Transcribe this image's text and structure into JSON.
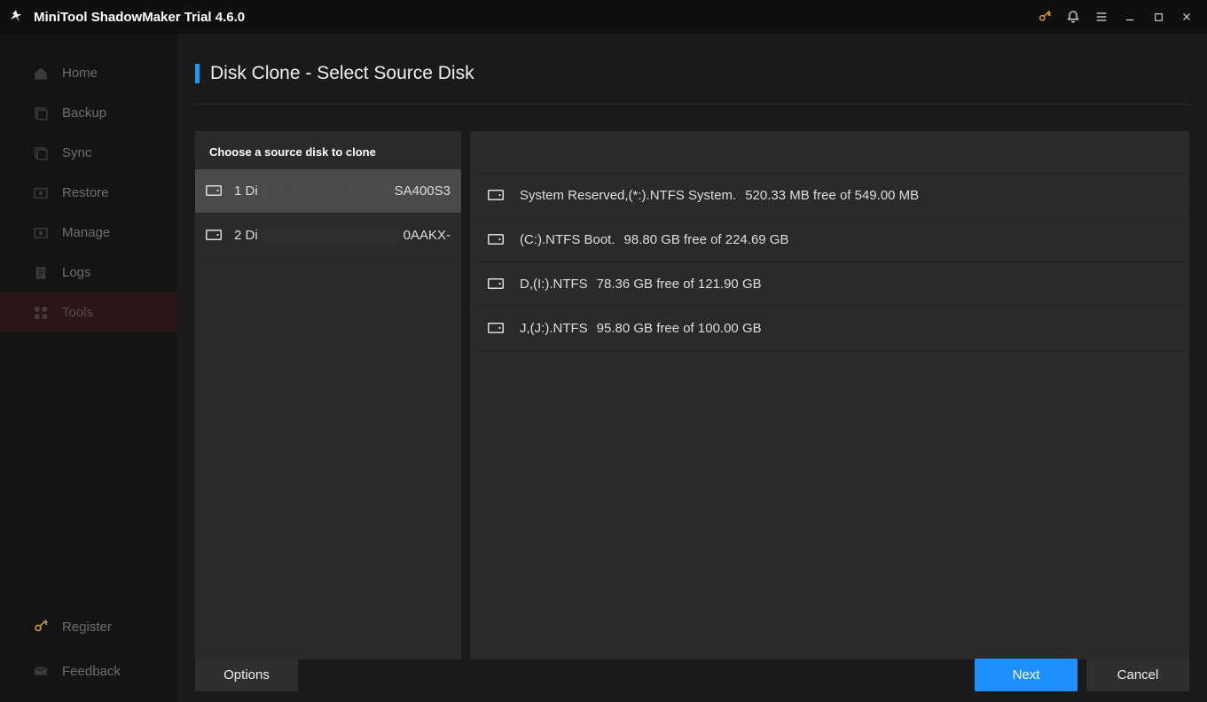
{
  "app": {
    "title": "MiniTool ShadowMaker Trial 4.6.0"
  },
  "sidebar": {
    "items": [
      {
        "label": "Home"
      },
      {
        "label": "Backup"
      },
      {
        "label": "Sync"
      },
      {
        "label": "Restore"
      },
      {
        "label": "Manage"
      },
      {
        "label": "Logs"
      },
      {
        "label": "Tools"
      }
    ],
    "register": "Register",
    "feedback": "Feedback"
  },
  "page": {
    "title": "Disk Clone - Select Source Disk"
  },
  "source_panel": {
    "heading": "Choose a source disk to clone",
    "disks": [
      {
        "prefix": "1 Di",
        "suffix": "SA400S3"
      },
      {
        "prefix": "2 Di",
        "suffix": "0AAKX-"
      }
    ]
  },
  "partitions": [
    {
      "name": "System Reserved,(*:).NTFS System.",
      "size": "520.33 MB free of 549.00 MB"
    },
    {
      "name": "(C:).NTFS Boot.",
      "size": "98.80 GB free of 224.69 GB"
    },
    {
      "name": "D,(I:).NTFS",
      "size": "78.36 GB free of 121.90 GB"
    },
    {
      "name": "J,(J:).NTFS",
      "size": "95.80 GB free of 100.00 GB"
    }
  ],
  "buttons": {
    "options": "Options",
    "next": "Next",
    "cancel": "Cancel"
  }
}
